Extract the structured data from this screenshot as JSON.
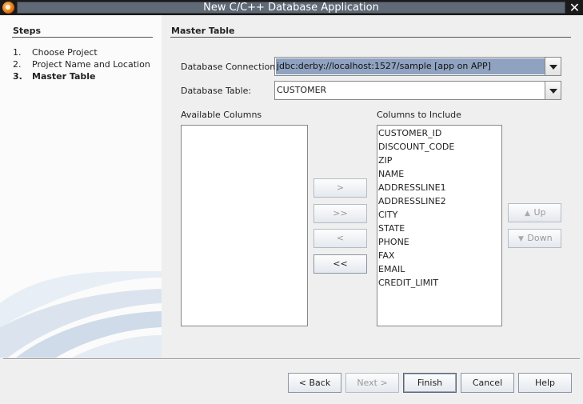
{
  "window": {
    "title": "New C/C++ Database Application",
    "close_glyph": "✕"
  },
  "steps": {
    "title": "Steps",
    "items": [
      {
        "num": "1.",
        "label": "Choose Project"
      },
      {
        "num": "2.",
        "label": "Project Name and Location"
      },
      {
        "num": "3.",
        "label": "Master Table"
      }
    ],
    "current_index": 2
  },
  "main": {
    "title": "Master Table",
    "db_connection_label": "Database Connection:",
    "db_connection_value": "jdbc:derby://localhost:1527/sample [app on APP]",
    "db_table_label": "Database Table:",
    "db_table_value": "CUSTOMER",
    "available_label": "Available Columns",
    "include_label": "Columns to Include",
    "available_columns": [],
    "include_columns": [
      "CUSTOMER_ID",
      "DISCOUNT_CODE",
      "ZIP",
      "NAME",
      "ADDRESSLINE1",
      "ADDRESSLINE2",
      "CITY",
      "STATE",
      "PHONE",
      "FAX",
      "EMAIL",
      "CREDIT_LIMIT"
    ],
    "move_buttons": {
      "add": ">",
      "add_all": ">>",
      "remove": "<",
      "remove_all": "<<"
    },
    "up_label": "Up",
    "down_label": "Down"
  },
  "footer": {
    "back": "< Back",
    "next": "Next >",
    "finish": "Finish",
    "cancel": "Cancel",
    "help": "Help"
  },
  "icons": {
    "app": "app-logo-icon",
    "close": "close-icon",
    "up": "arrow-up-icon",
    "down": "arrow-down-icon",
    "dropdown": "chevron-down-icon"
  },
  "colors": {
    "title_bar": "#5f6a76",
    "selection": "#8fa2c0",
    "panel": "#fbfbfb",
    "background": "#efefef"
  }
}
